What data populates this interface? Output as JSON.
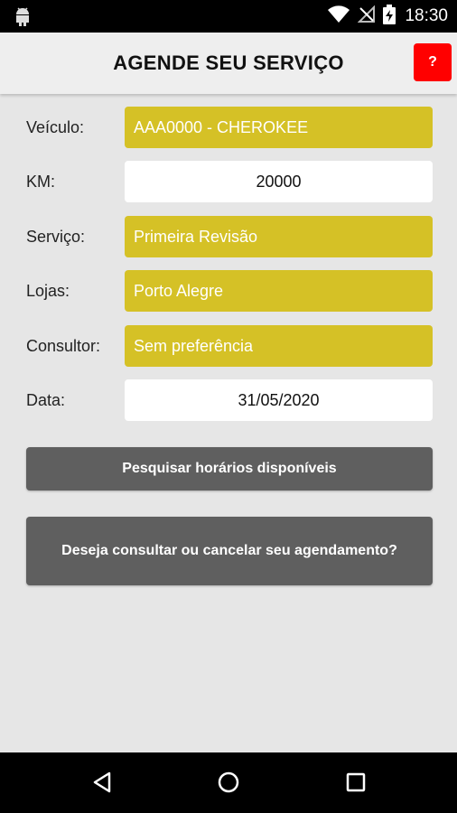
{
  "status_bar": {
    "time": "18:30",
    "icons": [
      "android-icon",
      "wifi-icon",
      "no-signal-icon",
      "battery-charging-icon"
    ]
  },
  "app_bar": {
    "title": "AGENDE SEU SERVIÇO",
    "help_label": "?"
  },
  "form": {
    "veiculo": {
      "label": "Veículo:",
      "value": "AAA0000 - CHEROKEE"
    },
    "km": {
      "label": "KM:",
      "value": "20000"
    },
    "servico": {
      "label": "Serviço:",
      "value": "Primeira Revisão"
    },
    "lojas": {
      "label": "Lojas:",
      "value": "Porto Alegre"
    },
    "consultor": {
      "label": "Consultor:",
      "value": "Sem preferência"
    },
    "data": {
      "label": "Data:",
      "value": "31/05/2020"
    }
  },
  "buttons": {
    "search": "Pesquisar horários disponíveis",
    "manage": "Deseja consultar ou cancelar seu agendamento?"
  },
  "colors": {
    "select_background": "#d5c126",
    "button_background": "#5f5f5f",
    "help_button": "#ff0000",
    "page_background": "#e6e6e6"
  },
  "nav_bar": {
    "icons": [
      "back-icon",
      "home-icon",
      "recents-icon"
    ]
  }
}
